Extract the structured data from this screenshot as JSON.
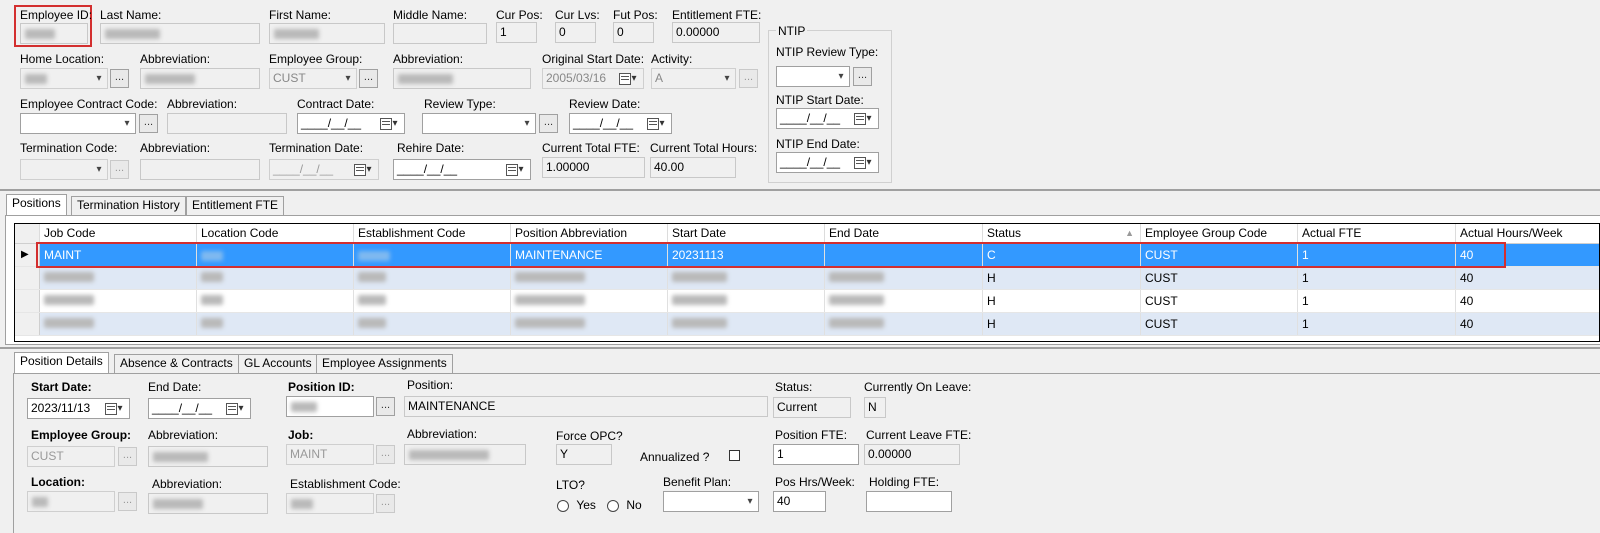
{
  "top": {
    "employee_id_label": "Employee ID:",
    "last_name_label": "Last Name:",
    "first_name_label": "First Name:",
    "middle_name_label": "Middle Name:",
    "cur_pos_label": "Cur Pos:",
    "cur_pos_value": "1",
    "cur_lvs_label": "Cur Lvs:",
    "cur_lvs_value": "0",
    "fut_pos_label": "Fut Pos:",
    "fut_pos_value": "0",
    "entitlement_fte_label": "Entitlement FTE:",
    "entitlement_fte_value": "0.00000",
    "home_location_label": "Home Location:",
    "abbreviation_label": "Abbreviation:",
    "employee_group_label": "Employee Group:",
    "employee_group_value": "CUST",
    "original_start_date_label": "Original Start Date:",
    "original_start_date_value": "2005/03/16",
    "activity_label": "Activity:",
    "activity_value": "A",
    "employee_contract_code_label": "Employee Contract Code:",
    "contract_date_label": "Contract Date:",
    "review_type_label": "Review Type:",
    "review_date_label": "Review Date:",
    "empty_date": "____/__/__",
    "termination_code_label": "Termination Code:",
    "termination_date_label": "Termination Date:",
    "rehire_date_label": "Rehire Date:",
    "current_total_fte_label": "Current Total FTE:",
    "current_total_fte_value": "1.00000",
    "current_total_hours_label": "Current Total Hours:",
    "current_total_hours_value": "40.00",
    "ellipsis": "..."
  },
  "ntip": {
    "title": "NTIP",
    "review_type_label": "NTIP Review Type:",
    "start_date_label": "NTIP Start Date:",
    "end_date_label": "NTIP End Date:"
  },
  "tabs_top": [
    "Positions",
    "Termination History",
    "Entitlement FTE"
  ],
  "grid": {
    "columns": [
      "Job Code",
      "Location Code",
      "Establishment Code",
      "Position Abbreviation",
      "Start Date",
      "End Date",
      "Status",
      "Employee Group Code",
      "Actual FTE",
      "Actual Hours/Week"
    ],
    "rows": [
      {
        "job_code": "MAINT",
        "position_abbreviation": "MAINTENANCE",
        "start_date": "20231113",
        "end_date": "",
        "status": "C",
        "employee_group_code": "CUST",
        "actual_fte": "1",
        "actual_hours": "40"
      },
      {
        "job_code": "",
        "position_abbreviation": "",
        "start_date": "",
        "end_date": "",
        "status": "H",
        "employee_group_code": "CUST",
        "actual_fte": "1",
        "actual_hours": "40"
      },
      {
        "job_code": "",
        "position_abbreviation": "",
        "start_date": "",
        "end_date": "",
        "status": "H",
        "employee_group_code": "CUST",
        "actual_fte": "1",
        "actual_hours": "40"
      },
      {
        "job_code": "",
        "position_abbreviation": "",
        "start_date": "",
        "end_date": "",
        "status": "H",
        "employee_group_code": "CUST",
        "actual_fte": "1",
        "actual_hours": "40"
      }
    ]
  },
  "tabs_bottom": [
    "Position Details",
    "Absence & Contracts",
    "GL Accounts",
    "Employee Assignments"
  ],
  "details": {
    "start_date_label": "Start Date:",
    "start_date_value": "2023/11/13",
    "end_date_label": "End Date:",
    "position_id_label": "Position ID:",
    "position_label": "Position:",
    "position_value": "MAINTENANCE",
    "status_label": "Status:",
    "status_value": "Current",
    "currently_on_leave_label": "Currently On Leave:",
    "currently_on_leave_value": "N",
    "employee_group_label": "Employee Group:",
    "employee_group_value": "CUST",
    "abbreviation_label": "Abbreviation:",
    "job_label": "Job:",
    "job_value": "MAINT",
    "force_opc_label": "Force OPC?",
    "force_opc_value": "Y",
    "annualized_label": "Annualized ?",
    "position_fte_label": "Position FTE:",
    "position_fte_value": "1",
    "current_leave_fte_label": "Current Leave FTE:",
    "current_leave_fte_value": "0.00000",
    "location_label": "Location:",
    "establishment_code_label": "Establishment Code:",
    "lto_label": "LTO?",
    "yes_label": "Yes",
    "no_label": "No",
    "benefit_plan_label": "Benefit Plan:",
    "pos_hrs_week_label": "Pos Hrs/Week:",
    "pos_hrs_week_value": "40",
    "holding_fte_label": "Holding FTE:"
  },
  "colors": {
    "selection": "#3399ff",
    "highlight_box": "#d32f2f",
    "alt_row": "#dfe8f5"
  }
}
